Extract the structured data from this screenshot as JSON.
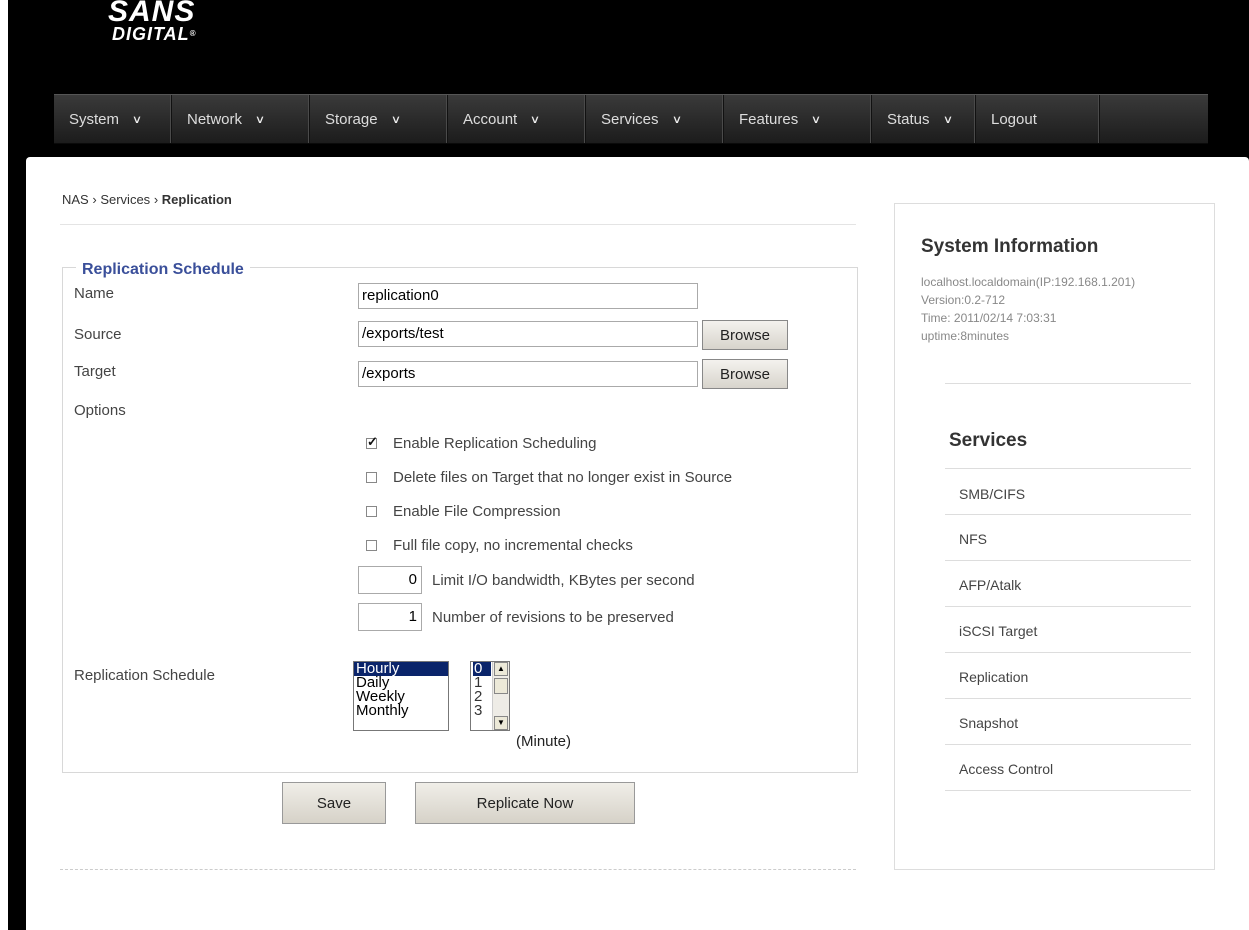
{
  "brand": {
    "line1": "SANS",
    "line2": "DIGITAL"
  },
  "nav": {
    "items": [
      {
        "label": "System"
      },
      {
        "label": "Network"
      },
      {
        "label": "Storage"
      },
      {
        "label": "Account"
      },
      {
        "label": "Services"
      },
      {
        "label": "Features"
      },
      {
        "label": "Status"
      }
    ],
    "logout": "Logout"
  },
  "breadcrumb": {
    "part1": "NAS",
    "part2": "Services",
    "current": "Replication",
    "sep": "›"
  },
  "form": {
    "legend": "Replication Schedule",
    "name_label": "Name",
    "name_value": "replication0",
    "source_label": "Source",
    "source_value": "/exports/test",
    "target_label": "Target",
    "target_value": "/exports",
    "browse_label": "Browse",
    "options_label": "Options",
    "options": [
      {
        "label": "Enable Replication Scheduling",
        "checked": true
      },
      {
        "label": "Delete files on Target that no longer exist in Source",
        "checked": false
      },
      {
        "label": "Enable File Compression",
        "checked": false
      },
      {
        "label": "Full file copy, no incremental checks",
        "checked": false
      }
    ],
    "bandwidth_value": "0",
    "bandwidth_label": "Limit I/O bandwidth, KBytes per second",
    "revisions_value": "1",
    "revisions_label": "Number of revisions to be preserved",
    "schedule_label": "Replication Schedule",
    "schedule_options": [
      "Hourly",
      "Daily",
      "Weekly",
      "Monthly"
    ],
    "schedule_selected": "Hourly",
    "minute_options": [
      "0",
      "1",
      "2",
      "3"
    ],
    "minute_selected": "0",
    "minute_label": "(Minute)",
    "save_label": "Save",
    "replicate_label": "Replicate Now"
  },
  "sidebar": {
    "title": "System Information",
    "host": "localhost.localdomain(IP:192.168.1.201)",
    "version": "Version:0.2-712",
    "time": "Time: 2011/02/14 7:03:31",
    "uptime": "uptime:8minutes",
    "services_title": "Services",
    "services": [
      "SMB/CIFS",
      "NFS",
      "AFP/Atalk",
      "iSCSI Target",
      "Replication",
      "Snapshot",
      "Access Control"
    ]
  }
}
